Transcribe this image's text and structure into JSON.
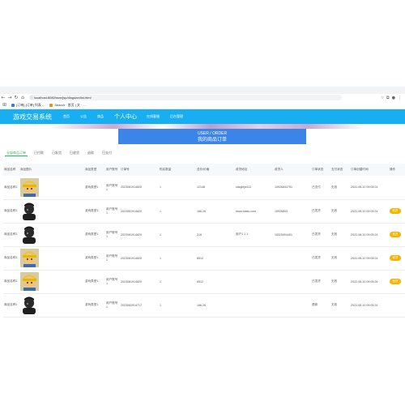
{
  "browser": {
    "url": "localhost:8080/ssm/jsp/dingdan/list.html",
    "bookmarks": [
      {
        "label": "[订单]-[订单] 列表 ...",
        "color": "#3b7be0"
      },
      {
        "label": "Search · 首页 | 文 · ...",
        "color": "#f58a1f"
      }
    ]
  },
  "header": {
    "brand": "游戏交易系统",
    "nav": [
      "首页",
      "公告",
      "商品",
      "个人中心",
      "在线客服",
      "后台管理"
    ]
  },
  "title_bar": {
    "en": "USER / ORDER",
    "zh": "我的商品订单"
  },
  "tabs": {
    "items": [
      "全部商品订单",
      "已付款",
      "已发货",
      "已收货",
      "退款",
      "已支付"
    ],
    "active_index": 0
  },
  "table": {
    "headers": [
      "商品名称",
      "商品图片",
      "商品类型",
      "用户账号",
      "订单号",
      "购买数量",
      "总价/价格",
      "收货地址",
      "收货人",
      "订单状态",
      "支付状态",
      "订单创建时间",
      "操作"
    ],
    "rows": [
      {
        "name": "商品名称1",
        "img": "boy",
        "type": "游戏类型1",
        "account": "用户账号1",
        "order_no": "2023081914820",
        "qty": "1",
        "price": "12148",
        "address": "xiaojiejie111",
        "receiver": "15926844751",
        "order_status": "已支付",
        "pay_status": "无效",
        "created": "2022-06-10 09:05:24",
        "action": ""
      },
      {
        "name": "商品名称1",
        "img": "dark",
        "type": "游戏类型1",
        "account": "用户账号1",
        "order_no": "2023081914820",
        "qty": "1",
        "price": "186.26",
        "address": "www.baidu.com",
        "receiver": "15926843",
        "order_status": "已发货",
        "pay_status": "无效",
        "created": "2022-06-10 09:05:24",
        "action": "收货"
      },
      {
        "name": "商品名称1",
        "img": "dark",
        "type": "游戏类型1",
        "account": "用户账号1",
        "order_no": "2023081914820",
        "qty": "1",
        "price": "216",
        "address": "用户1 1 1",
        "receiver": "15325404451",
        "order_status": "已发货",
        "pay_status": "无效",
        "created": "2022-06-10 09:05:24",
        "action": "收货"
      },
      {
        "name": "商品名称1",
        "img": "boy",
        "type": "游戏类型1",
        "account": "用户账号1",
        "order_no": "2023081914820",
        "qty": "1",
        "price": "8512",
        "address": "",
        "receiver": "",
        "order_status": "已发货",
        "pay_status": "无效",
        "created": "2022-06-10 09:05:24",
        "action": "收货"
      },
      {
        "name": "商品名称1",
        "img": "boy",
        "type": "游戏类型1",
        "account": "用户账号1",
        "order_no": "2023081914820",
        "qty": "1",
        "price": "8512",
        "address": "",
        "receiver": "",
        "order_status": "已发货",
        "pay_status": "无效",
        "created": "2022-06-10 09:05:26",
        "action": "收货"
      },
      {
        "name": "商品名称1",
        "img": "dark",
        "type": "游戏类型1",
        "account": "用户账号1",
        "order_no": "2023082914717",
        "qty": "1",
        "price": "186.26",
        "address": "",
        "receiver": "",
        "order_status": "退款",
        "pay_status": "无效",
        "created": "2022-06-10 09:05:24",
        "action": ""
      }
    ]
  },
  "colors": {
    "header": "#17aef2",
    "title_bar": "#3b85e8",
    "tab_active": "#2fb36a",
    "action_pill": "#f5b400"
  }
}
